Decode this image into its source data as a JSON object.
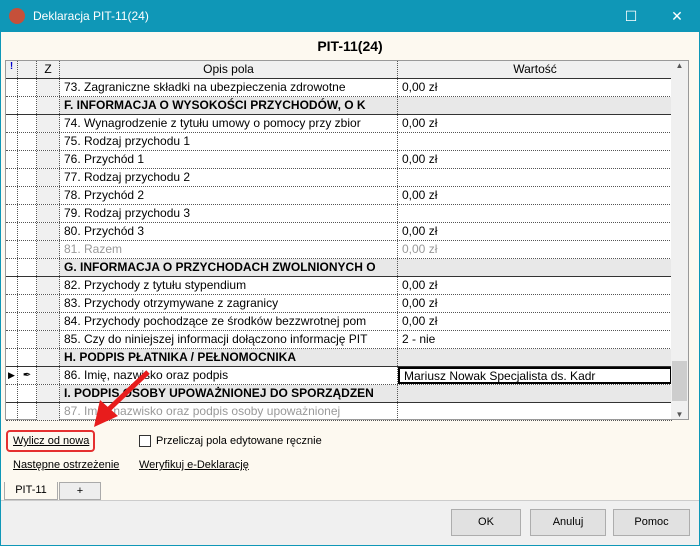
{
  "window": {
    "title": "Deklaracja PIT-11(24)",
    "icon_text": "GT"
  },
  "form_title": "PIT-11(24)",
  "grid": {
    "header": {
      "indicator": "!",
      "z": "Z",
      "opis": "Opis pola",
      "wartosc": "Wartość"
    },
    "rows": [
      {
        "type": "field",
        "opis": "73. Zagraniczne składki na ubezpieczenia zdrowotne",
        "wartosc": "0,00 zł"
      },
      {
        "type": "section",
        "opis": "F. INFORMACJA O WYSOKOŚCI PRZYCHODÓW, O K",
        "wartosc": ""
      },
      {
        "type": "field",
        "opis": "74. Wynagrodzenie z tytułu umowy o pomocy przy zbior",
        "wartosc": "0,00 zł"
      },
      {
        "type": "field",
        "opis": "75. Rodzaj przychodu 1",
        "wartosc": ""
      },
      {
        "type": "field",
        "opis": "76. Przychód 1",
        "wartosc": "0,00 zł"
      },
      {
        "type": "field",
        "opis": "77. Rodzaj przychodu 2",
        "wartosc": ""
      },
      {
        "type": "field",
        "opis": "78. Przychód 2",
        "wartosc": "0,00 zł"
      },
      {
        "type": "field",
        "opis": "79. Rodzaj przychodu 3",
        "wartosc": ""
      },
      {
        "type": "field",
        "opis": "80. Przychód 3",
        "wartosc": "0,00 zł"
      },
      {
        "type": "disabled",
        "opis": "81. Razem",
        "wartosc": "0,00 zł"
      },
      {
        "type": "section",
        "opis": "G. INFORMACJA O PRZYCHODACH ZWOLNIONYCH O",
        "wartosc": ""
      },
      {
        "type": "field",
        "opis": "82. Przychody z tytułu stypendium",
        "wartosc": "0,00 zł"
      },
      {
        "type": "field",
        "opis": "83. Przychody otrzymywane z zagranicy",
        "wartosc": "0,00 zł"
      },
      {
        "type": "field",
        "opis": "84. Przychody pochodzące ze środków bezzwrotnej pom",
        "wartosc": "0,00 zł"
      },
      {
        "type": "field",
        "opis": "85. Czy do niniejszej informacji dołączono informację PIT",
        "wartosc": "2 - nie"
      },
      {
        "type": "section",
        "opis": "H. PODPIS PŁATNIKA / PEŁNOMOCNIKA",
        "wartosc": ""
      },
      {
        "type": "current",
        "opis": "86. Imię, nazwisko oraz podpis",
        "wartosc": "Mariusz Nowak Specjalista ds. Kadr"
      },
      {
        "type": "section",
        "opis": "I. PODPIS OSOBY UPOWAŻNIONEJ DO SPORZĄDZEN",
        "wartosc": ""
      },
      {
        "type": "disabled",
        "opis": "87. Imię, nazwisko oraz podpis osoby upoważnionej",
        "wartosc": ""
      }
    ]
  },
  "links": {
    "recalc": "Wylicz od nowa",
    "next_warning": "Następne ostrzeżenie",
    "verify": "Weryfikuj e-Deklarację"
  },
  "checkbox": {
    "label": "Przeliczaj pola edytowane ręcznie",
    "checked": false
  },
  "tabs": [
    "PIT-11",
    "+"
  ],
  "buttons": {
    "ok": "OK",
    "cancel": "Anuluj",
    "help": "Pomoc"
  }
}
